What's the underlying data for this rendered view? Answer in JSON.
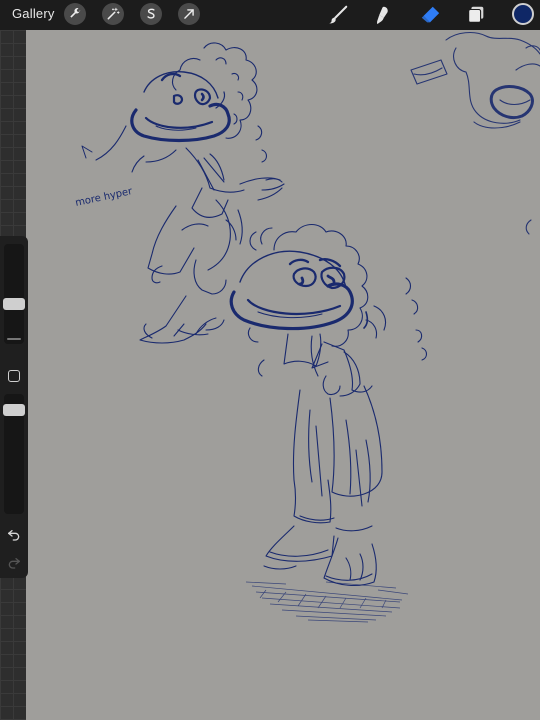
{
  "toolbar": {
    "gallery_label": "Gallery",
    "left_tools": [
      "wrench-icon",
      "magic-wand-icon",
      "selection-s-icon",
      "transform-arrow-icon"
    ],
    "right_tools": [
      "brush-icon",
      "smudge-icon",
      "eraser-icon",
      "layers-icon"
    ],
    "active_tool": "eraser-icon",
    "active_color": "#0f2766",
    "active_tool_color": "#2f7df6"
  },
  "sidebar": {
    "brush_size_level": 0.3,
    "opacity_level": 0.5
  },
  "canvas": {
    "background": "#9f9e9b",
    "ink_color": "#1a2a6e",
    "annotation_text": "more hyper"
  }
}
